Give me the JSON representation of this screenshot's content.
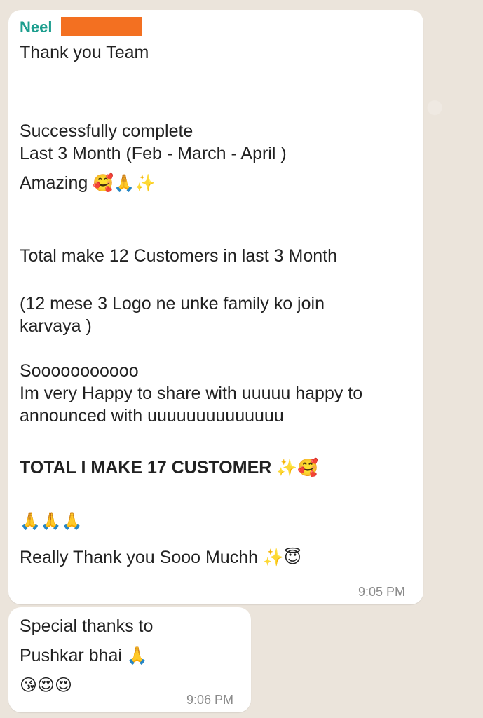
{
  "message1": {
    "sender": "Neel",
    "lines": [
      "Thank you Team",
      "Successfully complete",
      "Last 3 Month (Feb - March - April )",
      "Amazing",
      "Total make 12 Customers in last 3 Month",
      "(12 mese 3 Logo ne unke family ko join",
      "karvaya )",
      "Sooooooooooo",
      "Im very Happy to share with uuuuu happy to",
      "announced with uuuuuuuuuuuuuu",
      "TOTAL I MAKE 17 CUSTOMER",
      "Really Thank you Sooo Muchh"
    ],
    "emojis": {
      "amazing": "🥰🙏✨",
      "total": "✨🥰",
      "prayers": "🙏🙏🙏",
      "thanks": "✨😇"
    },
    "time": "9:05 PM"
  },
  "message2": {
    "lines": [
      "Special thanks to",
      "Pushkar bhai"
    ],
    "emojis": {
      "pushkar": "🙏",
      "faces": "😘😍😍"
    },
    "time": "9:06 PM"
  },
  "colors": {
    "sender_name": "#1c9e8e",
    "redaction": "#f37021",
    "bubble": "#ffffff",
    "background": "#ece5dd"
  }
}
